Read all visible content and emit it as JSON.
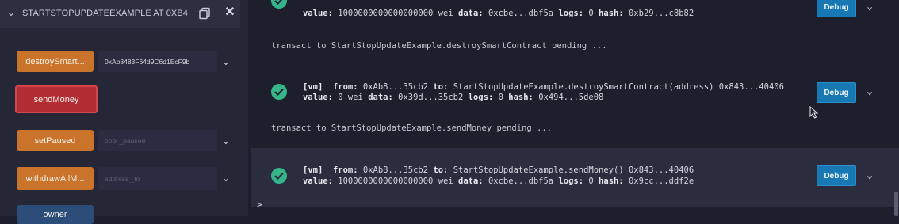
{
  "contract": {
    "title": "STARTSTOPUPDATEEXAMPLE AT 0XB4",
    "icons": {
      "collapse": "chevron-down-icon",
      "copy": "copy-icon",
      "close": "close-icon"
    }
  },
  "functions": [
    {
      "label": "destroySmart...",
      "input_value": "0xAb8483F64d9C6d1EcF9b",
      "placeholder": "",
      "color": "orange",
      "expand": "chevron-down-icon"
    },
    {
      "label": "sendMoney",
      "input_value": "",
      "placeholder": "",
      "color": "red",
      "expand": ""
    },
    {
      "label": "setPaused",
      "input_value": "",
      "placeholder": "bool _paused",
      "color": "orange",
      "expand": "chevron-down-icon"
    },
    {
      "label": "withdrawAllM...",
      "input_value": "",
      "placeholder": "address _to",
      "color": "orange",
      "expand": "chevron-down-icon"
    },
    {
      "label": "owner",
      "input_value": "",
      "placeholder": "",
      "color": "blue",
      "expand": ""
    }
  ],
  "terminal": {
    "tx0": {
      "value_label": "value:",
      "value": "1000000000000000000 wei",
      "data_label": "data:",
      "data": "0xcbe...dbf5a",
      "logs_label": "logs:",
      "logs": "0",
      "hash_label": "hash:",
      "hash": "0xb29...c8b82",
      "debug": "Debug"
    },
    "pending1": "transact to StartStopUpdateExample.destroySmartContract pending ...",
    "tx1": {
      "vm": "[vm]",
      "from_label": "from:",
      "from": "0xAb8...35cb2",
      "to_label": "to:",
      "to": "StartStopUpdateExample.destroySmartContract(address) 0x843...40406",
      "value_label": "value:",
      "value": "0 wei",
      "data_label": "data:",
      "data": "0x39d...35cb2",
      "logs_label": "logs:",
      "logs": "0",
      "hash_label": "hash:",
      "hash": "0x494...5de08",
      "debug": "Debug"
    },
    "pending2": "transact to StartStopUpdateExample.sendMoney pending ...",
    "tx2": {
      "vm": "[vm]",
      "from_label": "from:",
      "from": "0xAb8...35cb2",
      "to_label": "to:",
      "to": "StartStopUpdateExample.sendMoney() 0x843...40406",
      "value_label": "value:",
      "value": "1000000000000000000 wei",
      "data_label": "data:",
      "data": "0xcbe...dbf5a",
      "logs_label": "logs:",
      "logs": "0",
      "hash_label": "hash:",
      "hash": "0x9cc...ddf2e",
      "debug": "Debug"
    },
    "prompt": ">",
    "colors": {
      "success": "#35b68a",
      "debug": "#1778b3",
      "orange": "#c9742a",
      "red": "#b32e34",
      "blue": "#2c4d7a"
    }
  }
}
